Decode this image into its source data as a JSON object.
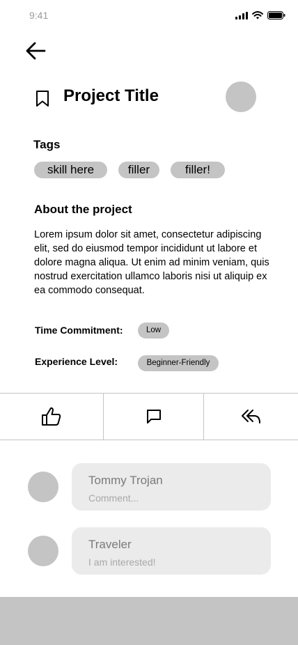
{
  "status_bar": {
    "time": "9:41"
  },
  "project": {
    "title": "Project Title"
  },
  "tags_section": {
    "heading": "Tags",
    "tags": [
      "skill here",
      "filler",
      "filler!"
    ]
  },
  "about": {
    "heading": "About the project",
    "text": "Lorem ipsum dolor sit amet, consectetur adipiscing elit, sed do eiusmod tempor incididunt ut labore et dolore magna aliqua. Ut enim ad minim veniam, quis nostrud exercitation ullamco laboris nisi ut aliquip ex ea commodo consequat."
  },
  "details": {
    "time_label": "Time Commitment:",
    "time_value": "Low",
    "experience_label": "Experience Level:",
    "experience_value": "Beginner-Friendly"
  },
  "actions": [
    "thumbs-up-icon",
    "comment-icon",
    "reply-icon"
  ],
  "comments": [
    {
      "name": "Tommy Trojan",
      "text": "Comment..."
    },
    {
      "name": "Traveler",
      "text": "I am interested!"
    }
  ],
  "colors": {
    "placeholder": "#c4c4c4",
    "bubble": "#ebebeb"
  }
}
